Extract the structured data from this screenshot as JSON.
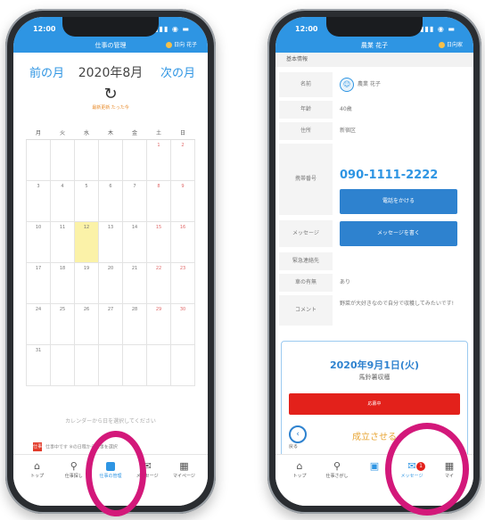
{
  "left": {
    "status_time": "12:00",
    "header_title": "仕事の管理",
    "user_label": "日向 花子",
    "prev_month": "前の月",
    "current_month": "2020年8月",
    "next_month": "次の月",
    "reload_label": "最新更新 たった今",
    "weekdays": [
      "月",
      "火",
      "水",
      "木",
      "金",
      "土",
      "日"
    ],
    "weeks": [
      [
        "",
        "",
        "",
        "",
        "",
        "1",
        "2"
      ],
      [
        "3",
        "4",
        "5",
        "6",
        "7",
        "8",
        "9"
      ],
      [
        "10",
        "11",
        "12",
        "13",
        "14",
        "15",
        "16"
      ],
      [
        "17",
        "18",
        "19",
        "20",
        "21",
        "22",
        "23"
      ],
      [
        "24",
        "25",
        "26",
        "27",
        "28",
        "29",
        "30"
      ],
      [
        "31",
        "",
        "",
        "",
        "",
        "",
        ""
      ]
    ],
    "highlighted_day": "12",
    "hint": "カレンダーから日を選択してください",
    "legend_badge": "仕事",
    "legend_text": "仕事中です ※の日程から仕事を選択",
    "tabs": [
      {
        "label": "トップ",
        "icon": "home-icon"
      },
      {
        "label": "仕事探し",
        "icon": "search-icon"
      },
      {
        "label": "仕事の管理",
        "icon": "calendar-icon"
      },
      {
        "label": "メッセージ",
        "icon": "message-icon"
      },
      {
        "label": "マイページ",
        "icon": "building-icon"
      }
    ]
  },
  "right": {
    "status_time": "12:00",
    "header_title": "農業 花子",
    "user_label": "日向家",
    "section_title": "基本情報",
    "rows": {
      "name_key": "名前",
      "name_value": "農業 花子",
      "age_key": "年齢",
      "age_value": "40歳",
      "address_key": "住所",
      "address_value": "新宿区",
      "phone_key": "携帯番号",
      "phone_value": "090-1111-2222",
      "message_key": "メッセージ",
      "emergency_key": "緊急連絡先",
      "car_key": "車の有無",
      "car_value": "あり",
      "comment_key": "コメント",
      "comment_value": "野菜が大好きなので自分で収穫してみたいです!"
    },
    "call_button": "電話をかける",
    "message_button": "メッセージを書く",
    "card_date": "2020年9月1日(火)",
    "card_sub": "馬鈴薯収穫",
    "status_button": "応募中",
    "back_label": "戻る",
    "done_text": "成立させる",
    "notif_count": "1",
    "tabs": [
      {
        "label": "トップ",
        "icon": "home-icon"
      },
      {
        "label": "仕事さがし",
        "icon": "search-icon"
      },
      {
        "label": "",
        "icon": "calendar-icon"
      },
      {
        "label": "メッセージ",
        "icon": "message-icon"
      },
      {
        "label": "マイ",
        "icon": "building-icon"
      }
    ]
  },
  "colors": {
    "accent": "#2e95e3",
    "highlight": "#d3187a",
    "alert": "#e3211b",
    "selected_day": "#fbf2a8"
  }
}
